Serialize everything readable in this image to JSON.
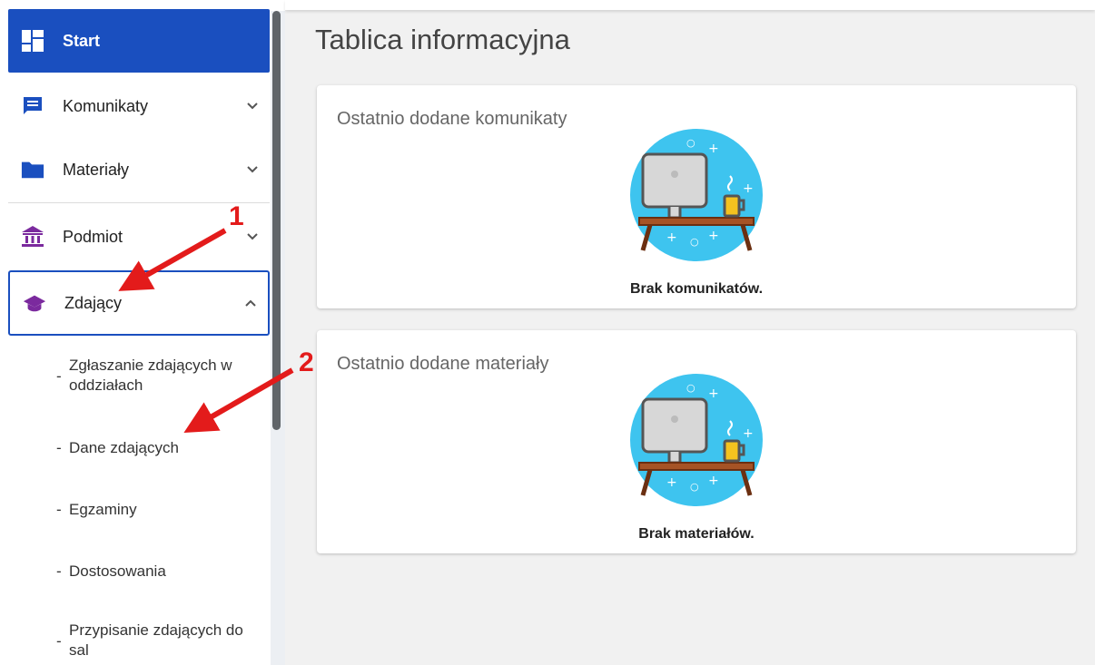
{
  "sidebar": {
    "items": [
      {
        "label": "Start",
        "icon": "dashboard-icon"
      },
      {
        "label": "Komunikaty",
        "icon": "message-icon"
      },
      {
        "label": "Materiały",
        "icon": "folder-icon"
      },
      {
        "label": "Podmiot",
        "icon": "institution-icon"
      },
      {
        "label": "Zdający",
        "icon": "graduation-cap-icon"
      }
    ],
    "subitems": [
      {
        "dash": "-",
        "label": "Zgłaszanie zdających w oddziałach"
      },
      {
        "dash": "-",
        "label": "Dane zdających"
      },
      {
        "dash": "-",
        "label": "Egzaminy"
      },
      {
        "dash": "-",
        "label": "Dostosowania"
      },
      {
        "dash": "-",
        "label": "Przypisanie zdających do sal"
      }
    ]
  },
  "main": {
    "title": "Tablica informacyjna",
    "cards": [
      {
        "title": "Ostatnio dodane komunikaty",
        "empty": "Brak komunikatów."
      },
      {
        "title": "Ostatnio dodane materiały",
        "empty": "Brak materiałów."
      }
    ]
  },
  "annotations": [
    "1",
    "2"
  ],
  "colors": {
    "primary": "#1a4fbf",
    "accent_purple": "#7b2a9e",
    "annotation": "#e31b1b",
    "illustration_bg": "#3ec4ef"
  }
}
